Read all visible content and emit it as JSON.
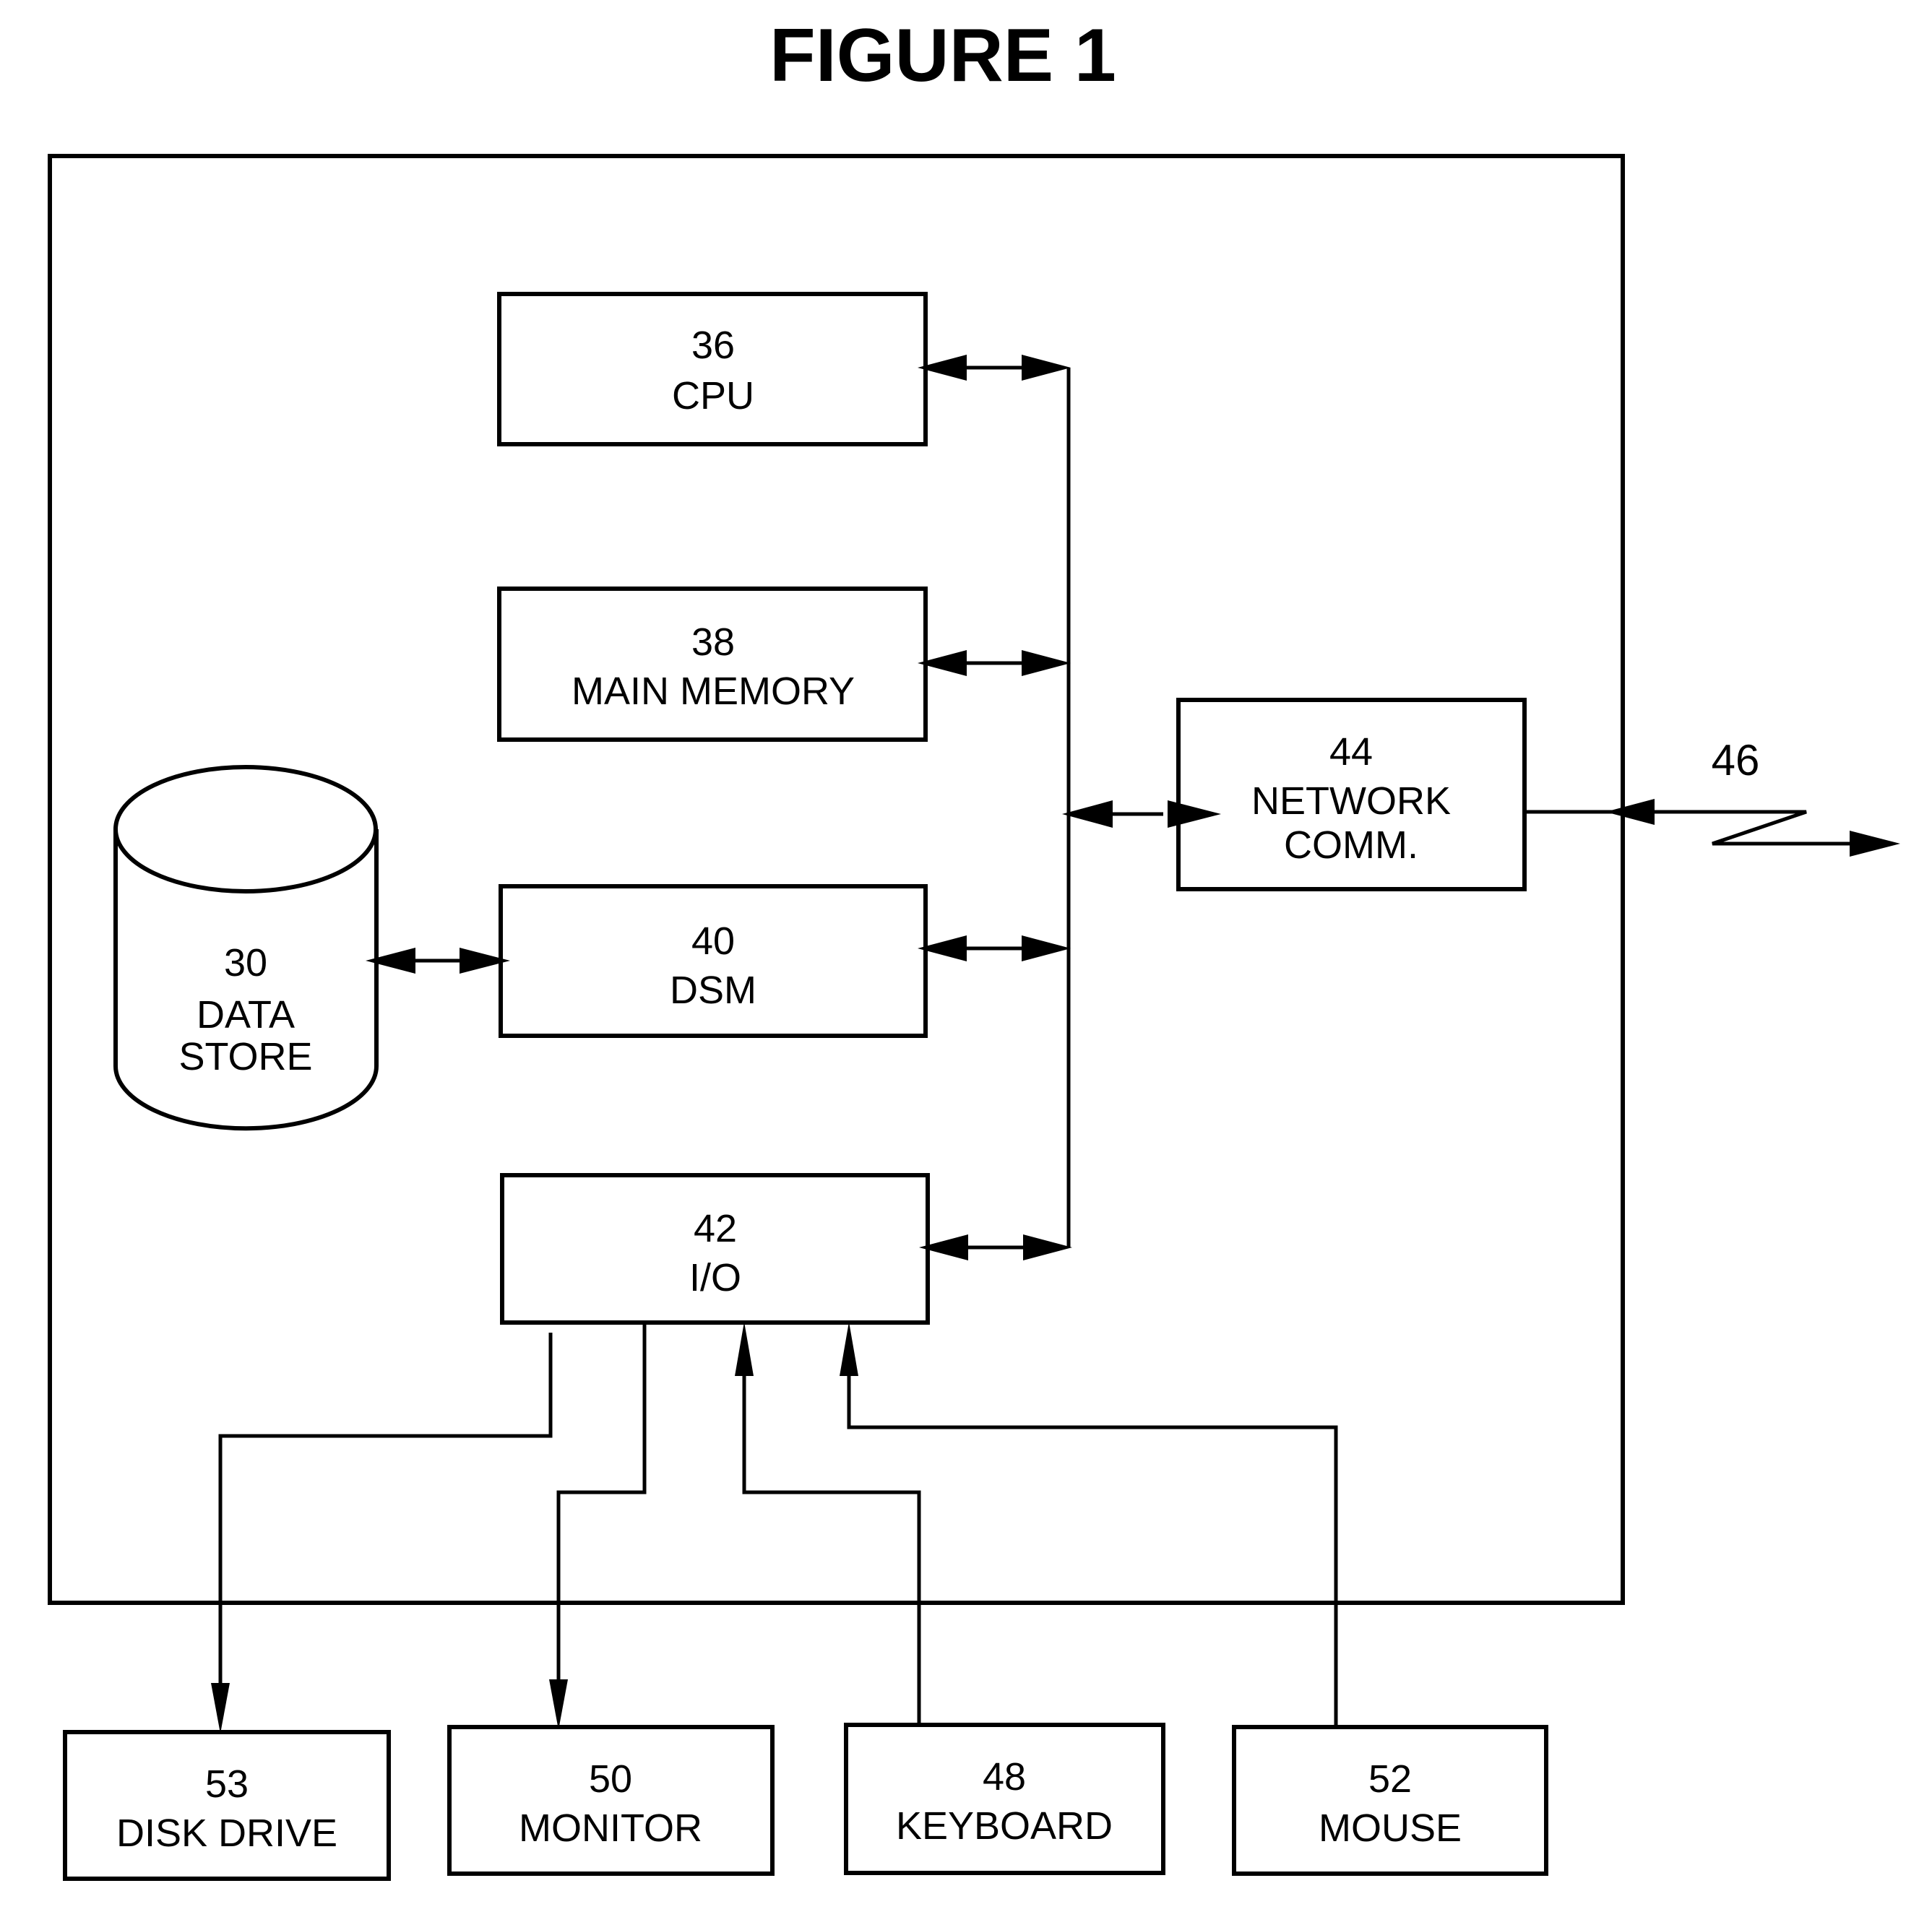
{
  "figure": {
    "title": "FIGURE 1"
  },
  "components": {
    "cpu": {
      "ref": "36",
      "label": "CPU"
    },
    "main_memory": {
      "ref": "38",
      "label": "MAIN MEMORY"
    },
    "dsm": {
      "ref": "40",
      "label": "DSM"
    },
    "io": {
      "ref": "42",
      "label": "I/O"
    },
    "network_comm": {
      "ref": "44",
      "label_line1": "NETWORK",
      "label_line2": "COMM."
    },
    "data_store": {
      "ref": "30",
      "label_line1": "DATA",
      "label_line2": "STORE"
    },
    "disk_drive": {
      "ref": "53",
      "label": "DISK DRIVE"
    },
    "monitor": {
      "ref": "50",
      "label": "MONITOR"
    },
    "keyboard": {
      "ref": "48",
      "label": "KEYBOARD"
    },
    "mouse": {
      "ref": "52",
      "label": "MOUSE"
    }
  },
  "network_link": {
    "ref": "46"
  },
  "connections": [
    {
      "from": "cpu",
      "to": "bus",
      "direction": "bidirectional"
    },
    {
      "from": "main_memory",
      "to": "bus",
      "direction": "bidirectional"
    },
    {
      "from": "dsm",
      "to": "bus",
      "direction": "bidirectional"
    },
    {
      "from": "io",
      "to": "bus",
      "direction": "bidirectional"
    },
    {
      "from": "bus",
      "to": "network_comm",
      "direction": "bidirectional"
    },
    {
      "from": "data_store",
      "to": "dsm",
      "direction": "bidirectional"
    },
    {
      "from": "network_comm",
      "to": "network_link",
      "direction": "bidirectional"
    },
    {
      "from": "io",
      "to": "disk_drive",
      "direction": "out"
    },
    {
      "from": "io",
      "to": "monitor",
      "direction": "out"
    },
    {
      "from": "keyboard",
      "to": "io",
      "direction": "in"
    },
    {
      "from": "mouse",
      "to": "io",
      "direction": "in"
    }
  ]
}
